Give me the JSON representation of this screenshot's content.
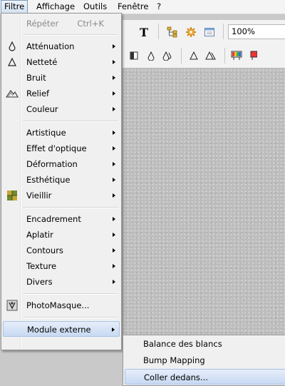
{
  "menubar": {
    "items": [
      "Filtre",
      "Affichage",
      "Outils",
      "Fenêtre",
      "?"
    ]
  },
  "toolbar": {
    "zoom": "100%"
  },
  "menu": {
    "repeat": {
      "label": "Répéter",
      "shortcut": "Ctrl+K"
    },
    "items": [
      {
        "label": "Atténuation",
        "icon": "attenuation-drop-icon"
      },
      {
        "label": "Netteté",
        "icon": "sharpen-triangle-icon"
      },
      {
        "label": "Bruit"
      },
      {
        "label": "Relief",
        "icon": "relief-icon"
      },
      {
        "label": "Couleur"
      },
      {
        "label": "Artistique"
      },
      {
        "label": "Effet d'optique"
      },
      {
        "label": "Déformation"
      },
      {
        "label": "Esthétique"
      },
      {
        "label": "Vieillir",
        "icon": "aging-icon"
      },
      {
        "label": "Encadrement"
      },
      {
        "label": "Aplatir"
      },
      {
        "label": "Contours"
      },
      {
        "label": "Texture"
      },
      {
        "label": "Divers"
      },
      {
        "label": "PhotoMasque...",
        "icon": "photomask-icon"
      },
      {
        "label": "Module externe"
      }
    ]
  },
  "submenu": {
    "items": [
      "Balance des blancs",
      "Bump Mapping",
      "Coller dedans..."
    ]
  },
  "colors": {
    "highlight_start": "#e6eefa",
    "highlight_end": "#c7d9f2",
    "highlight_border": "#a9c3e6"
  }
}
